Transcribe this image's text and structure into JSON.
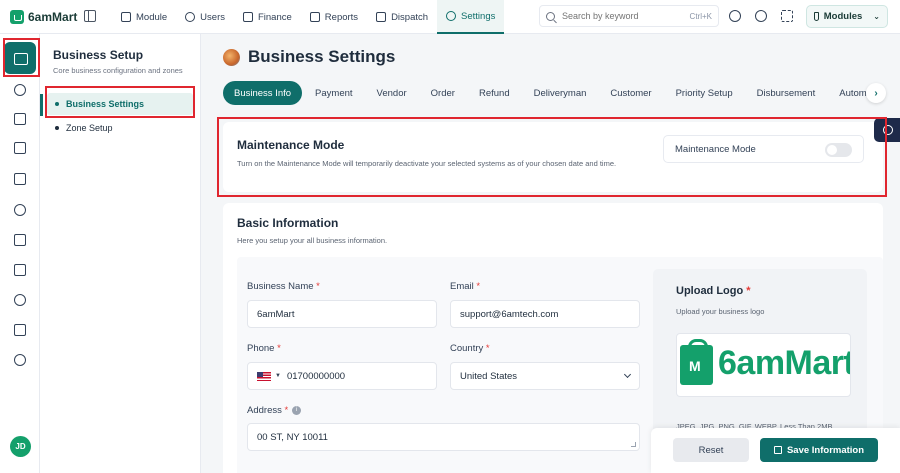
{
  "brand": {
    "name": "6amMart"
  },
  "topnav": {
    "items": [
      {
        "label": "Module",
        "icon": "cube-icon"
      },
      {
        "label": "Users",
        "icon": "users-icon"
      },
      {
        "label": "Finance",
        "icon": "wallet-icon"
      },
      {
        "label": "Reports",
        "icon": "chart-icon"
      },
      {
        "label": "Dispatch",
        "icon": "dispatch-icon"
      },
      {
        "label": "Settings",
        "icon": "gear-icon",
        "active": true
      }
    ],
    "search_placeholder": "Search by keyword",
    "search_shortcut": "Ctrl+K",
    "modules_label": "Modules"
  },
  "rail": {
    "icons": [
      "business-icon",
      "modules-icon",
      "card-icon",
      "money-icon",
      "document-icon",
      "gear-icon",
      "lock-icon",
      "mail-icon",
      "plug-icon",
      "image-icon",
      "database-icon"
    ],
    "avatar_initials": "JD"
  },
  "submenu": {
    "title": "Business Setup",
    "description": "Core business configuration and zones",
    "items": [
      {
        "label": "Business Settings",
        "active": true
      },
      {
        "label": "Zone Setup",
        "active": false
      }
    ]
  },
  "page": {
    "title": "Business Settings",
    "tabs": [
      {
        "label": "Business Info",
        "active": true
      },
      {
        "label": "Payment"
      },
      {
        "label": "Vendor"
      },
      {
        "label": "Order"
      },
      {
        "label": "Refund"
      },
      {
        "label": "Deliveryman"
      },
      {
        "label": "Customer"
      },
      {
        "label": "Priority Setup"
      },
      {
        "label": "Disbursement"
      },
      {
        "label": "Automated"
      }
    ]
  },
  "maintenance": {
    "title": "Maintenance Mode",
    "description": "Turn on the Maintenance Mode will temporarily deactivate your selected systems as of your chosen date and time.",
    "toggle_label": "Maintenance Mode",
    "enabled": false
  },
  "basic_info": {
    "title": "Basic Information",
    "description": "Here you setup your all business information.",
    "business_name_label": "Business Name",
    "business_name_value": "6amMart",
    "email_label": "Email",
    "email_value": "support@6amtech.com",
    "phone_label": "Phone",
    "phone_value": "01700000000",
    "country_label": "Country",
    "country_value": "United States",
    "address_label": "Address",
    "address_value": "00 ST, NY 10011",
    "required_mark": "*"
  },
  "upload_logo": {
    "title": "Upload Logo",
    "description": "Upload your business logo",
    "logo_text": "6amMart",
    "hint": "JPEG, JPG, PNG, GIF, WEBP. Less Than 2MB"
  },
  "footer": {
    "reset_label": "Reset",
    "save_label": "Save Information"
  },
  "colors": {
    "primary": "#0f6e6a",
    "brand_green": "#14a06b",
    "highlight_red": "#e0262f"
  }
}
